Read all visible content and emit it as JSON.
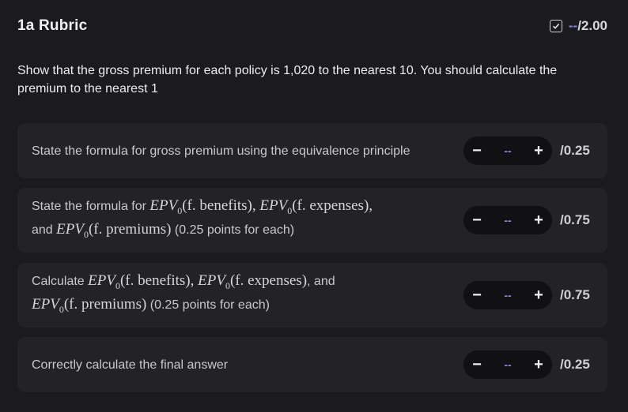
{
  "header": {
    "title": "1a Rubric",
    "score_value": "--",
    "score_max": "/2.00"
  },
  "question": "Show that the gross premium for each policy is 1,020 to the nearest 10. You should calculate the premium to the nearest 1",
  "math": {
    "epv": "EPV",
    "sub0": "0",
    "benefits": "(f. benefits)",
    "expenses": "(f. expenses)",
    "premiums": "(f. premiums)",
    "comma": ",",
    "and": " and ",
    "and_comma": ", and"
  },
  "criteria": [
    {
      "text": "State the formula for gross premium using the equivalence principle",
      "value": "--",
      "max": "/0.25",
      "minus": "−",
      "plus": "+"
    },
    {
      "text_prefix": "State the formula for ",
      "text_lead": "and ",
      "text_suffix": " (0.25 points for each)",
      "value": "--",
      "max": "/0.75",
      "minus": "−",
      "plus": "+"
    },
    {
      "text_prefix": "Calculate ",
      "text_suffix": " (0.25 points for each)",
      "value": "--",
      "max": "/0.75",
      "minus": "−",
      "plus": "+"
    },
    {
      "text": "Correctly calculate the final answer",
      "value": "--",
      "max": "/0.25",
      "minus": "−",
      "plus": "+"
    }
  ]
}
